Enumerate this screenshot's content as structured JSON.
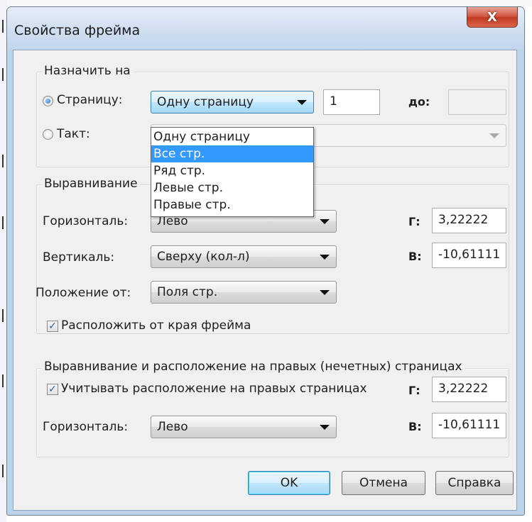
{
  "dialog": {
    "title": "Свойства фрейма",
    "close_glyph": "X"
  },
  "assign": {
    "legend": "Назначить на",
    "page_radio_label": "Страницу:",
    "page_radio_selected": true,
    "page_combo_value": "Одну страницу",
    "page_number_value": "1",
    "to_label": "до:",
    "to_value": "",
    "beat_radio_label": "Такт:",
    "beat_radio_selected": false,
    "beat_combo_value": "",
    "page_options": [
      {
        "label": "Одну страницу",
        "highlighted": false
      },
      {
        "label": "Все стр.",
        "highlighted": true
      },
      {
        "label": "Ряд стр.",
        "highlighted": false
      },
      {
        "label": "Левые стр.",
        "highlighted": false
      },
      {
        "label": "Правые стр.",
        "highlighted": false
      }
    ]
  },
  "alignment": {
    "legend": "Выравнивание",
    "horizontal_label": "Горизонталь:",
    "horizontal_value": "Лево",
    "vertical_label": "Вертикаль:",
    "vertical_value": "Сверху (кол-л)",
    "position_label": "Положение от:",
    "position_value": "Поля стр.",
    "h_offset_label": "Г:",
    "h_offset_value": "3,22222",
    "v_offset_label": "В:",
    "v_offset_value": "-10,61111",
    "frame_edge_checkbox_label": "Расположить от края фрейма",
    "frame_edge_checked": true
  },
  "right_pages": {
    "legend": "Выравнивание и расположение на правых (нечетных) страницах",
    "consider_checkbox_label": "Учитывать расположение на правых страницах",
    "consider_checked": true,
    "h_offset_label": "Г:",
    "h_offset_value": "3,22222",
    "horizontal_label": "Горизонталь:",
    "horizontal_value": "Лево",
    "v_offset_label": "В:",
    "v_offset_value": "-10,61111"
  },
  "buttons": {
    "ok": "OK",
    "cancel": "Отмена",
    "help": "Справка"
  },
  "colors": {
    "selection": "#3399ff",
    "window_frame": "#bcd3ec",
    "close_button": "#c23920",
    "dialog_face": "#f0f0f0"
  }
}
